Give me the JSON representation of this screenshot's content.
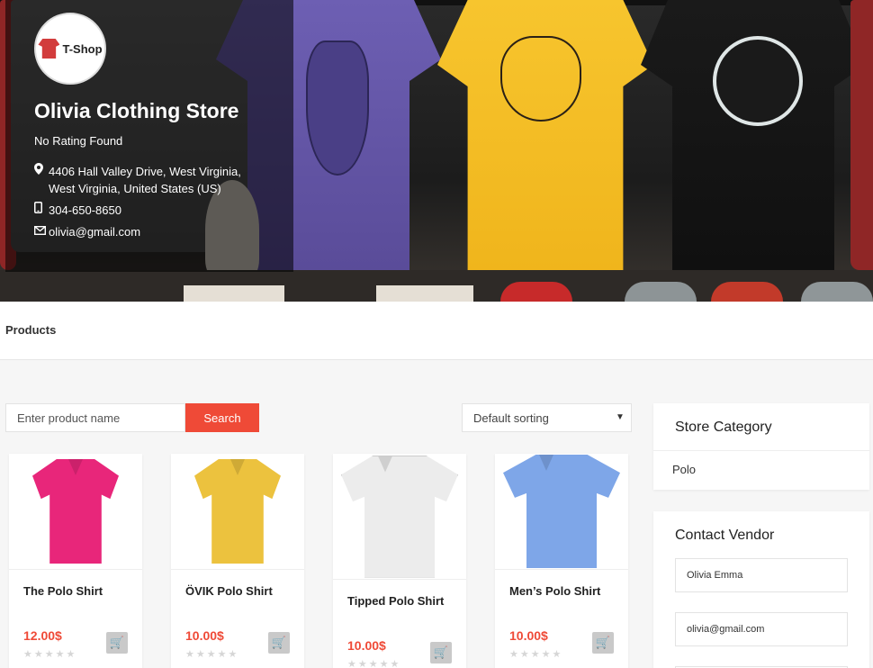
{
  "store": {
    "logo_text": "T-Shop",
    "name": "Olivia Clothing Store",
    "rating": "No Rating Found",
    "address": "4406 Hall Valley Drive, West Virginia, West Virginia, United States (US)",
    "phone": "304-650-8650",
    "email": "olivia@gmail.com"
  },
  "tabs": {
    "products": "Products"
  },
  "search": {
    "placeholder": "Enter product name",
    "button": "Search"
  },
  "sorting": {
    "selected": "Default sorting"
  },
  "products": [
    {
      "title": "The Polo Shirt",
      "price": "12.00$",
      "color": "#e8267a"
    },
    {
      "title": "ÖVIK Polo Shirt",
      "price": "10.00$",
      "color": "#ecc23e"
    },
    {
      "title": "Tipped Polo Shirt",
      "price": "10.00$",
      "color": "#ececec"
    },
    {
      "title": "Men’s Polo Shirt",
      "price": "10.00$",
      "color": "#7ea6e8"
    }
  ],
  "sidebar": {
    "category_title": "Store Category",
    "category_items": [
      "Polo"
    ],
    "contact_title": "Contact Vendor",
    "contact_name": "Olivia Emma",
    "contact_email": "olivia@gmail.com"
  },
  "icons": {
    "location": "map-marker-icon",
    "phone": "mobile-phone-icon",
    "email": "envelope-icon",
    "cart": "cart-icon",
    "stars": "star-icon"
  }
}
